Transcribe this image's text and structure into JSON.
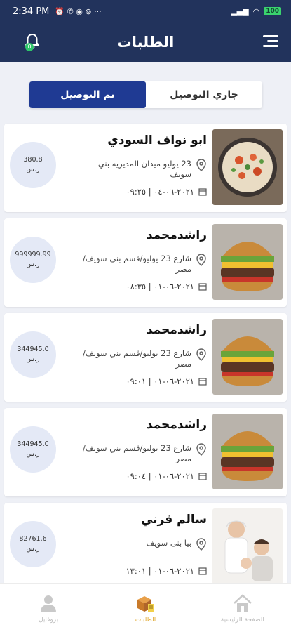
{
  "status_bar": {
    "time": "2:34 PM",
    "battery": "100"
  },
  "app_bar": {
    "title": "الطلبات",
    "notification_count": "0"
  },
  "tabs": [
    {
      "label": "جاري التوصيل",
      "active": false
    },
    {
      "label": "تم التوصيل",
      "active": true
    }
  ],
  "orders": [
    {
      "name": "ابو نواف السودي",
      "address": "23 يوليو ميدان المديريه بني سويف",
      "date": "٢٠٢١-٠٦-٠٤ | ٠٩:٢٥",
      "price": "380.8",
      "currency": "ر.س",
      "image": "food-platter"
    },
    {
      "name": "راشدمحمد",
      "address": "شارع 23 يوليو/قسم بني سويف/مصر",
      "date": "٢٠٢١-٠٦-٠١ | ٠٨:٣٥",
      "price": "999999.99",
      "currency": "ر.س",
      "image": "burger"
    },
    {
      "name": "راشدمحمد",
      "address": "شارع 23 يوليو/قسم بني سويف/مصر",
      "date": "٢٠٢١-٠٦-٠١ | ٠٩:٠١",
      "price": "344945.0",
      "currency": "ر.س",
      "image": "burger"
    },
    {
      "name": "راشدمحمد",
      "address": "شارع 23 يوليو/قسم بني سويف/مصر",
      "date": "٢٠٢١-٠٦-٠١ | ٠٩:٠٤",
      "price": "344945.0",
      "currency": "ر.س",
      "image": "burger"
    },
    {
      "name": "سالم قرني",
      "address": "بيا بنى سويف",
      "date": "٢٠٢١-٠٦-٠١ | ١٣:٠١",
      "price": "82761.6",
      "currency": "ر.س",
      "image": "family-photo"
    }
  ],
  "bottom_nav": [
    {
      "label": "الصفحة الرئيسية",
      "icon": "home-icon",
      "active": false
    },
    {
      "label": "الطلبات",
      "icon": "orders-box-icon",
      "active": true
    },
    {
      "label": "بروفايل",
      "icon": "profile-icon",
      "active": false
    }
  ],
  "colors": {
    "primary": "#22335c",
    "tab_active": "#1f3a93",
    "accent": "#e0a62a",
    "price_bg": "#e4e9f6"
  }
}
